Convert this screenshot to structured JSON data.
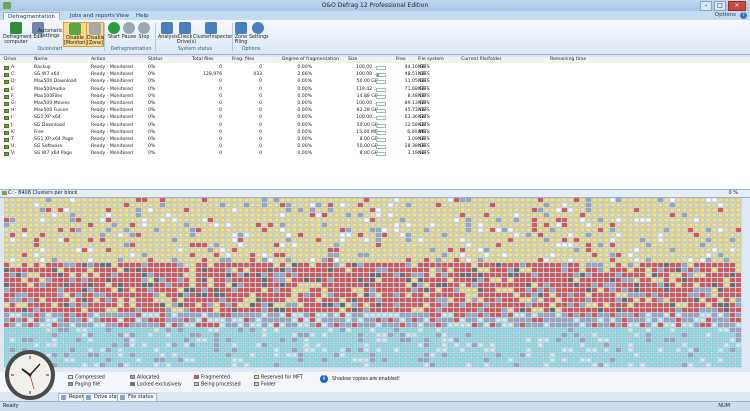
{
  "window": {
    "title": "O&O Defrag 12 Professional Edition"
  },
  "menu_tabs": [
    "Defragmentation",
    "Jobs and reports",
    "View",
    "Help"
  ],
  "options_label": "Options",
  "help_glyph": "?",
  "ribbon": {
    "buttons": [
      {
        "label1": "Defragment",
        "label2": "computer",
        "icon": "defragment-icon",
        "color": "#2f8a3a"
      },
      {
        "label1": "Edit",
        "label2": "settings",
        "icon": "edit-icon",
        "color": "#6c88a8"
      },
      {
        "label1": "Automatic",
        "label2": "",
        "icon": "automatic-icon",
        "color": "#6c88a8"
      },
      {
        "label1": "Disable",
        "label2": "[Monitoring]",
        "icon": "disable-monitoring-icon",
        "color": "#5aa642"
      },
      {
        "label1": "Disable",
        "label2": "[Zone]",
        "icon": "disable-zone-icon",
        "color": "#a8a8a8"
      },
      {
        "label1": "Start",
        "label2": "",
        "icon": "start-icon",
        "color": "#2e9e3c"
      },
      {
        "label1": "Pause",
        "label2": "",
        "icon": "pause-icon",
        "color": "#9aa8b6"
      },
      {
        "label1": "Stop",
        "label2": "",
        "icon": "stop-icon",
        "color": "#9aa8b6"
      },
      {
        "label1": "Analysis",
        "label2": "",
        "icon": "analysis-icon",
        "color": "#4a7fbf"
      },
      {
        "label1": "Check",
        "label2": "Drive(s)",
        "icon": "check-drive-icon",
        "color": "#4a7fbf"
      },
      {
        "label1": "ClusterInspector",
        "label2": "",
        "icon": "cluster-inspector-icon",
        "color": "#4a7fbf"
      },
      {
        "label1": "Zone",
        "label2": "Filing",
        "icon": "zone-filing-icon",
        "color": "#4a7fbf"
      },
      {
        "label1": "Settings",
        "label2": "",
        "icon": "settings-icon",
        "color": "#4a7fbf"
      }
    ],
    "groups": [
      "Quickstart",
      "Defragmentation",
      "System status",
      "Options"
    ]
  },
  "drive_columns": [
    "Drive",
    "Name",
    "Action",
    "Status",
    "Total files",
    "Frag. files",
    "Degree of fragmentation",
    "Size",
    "Free",
    "File system",
    "Current file/folder",
    "Remaining time"
  ],
  "drives": [
    {
      "drive": "A:",
      "name": "Backup",
      "action": "Ready - Monitored",
      "status": "0%",
      "total": "0",
      "frag": "0",
      "degree": "0.00%",
      "size": "100.00 ...",
      "free": "44.16 GB",
      "fs": "NTFS"
    },
    {
      "drive": "C:",
      "name": "SG W7 x64",
      "action": "Ready - Monitored",
      "status": "0%",
      "total": "128,976",
      "frag": "433",
      "degree": "2.66%",
      "size": "100.00 ...",
      "free": "48.51 GB",
      "fs": "NTFS"
    },
    {
      "drive": "D:",
      "name": "Max500 Download",
      "action": "Ready - Monitored",
      "status": "0%",
      "total": "0",
      "frag": "0",
      "degree": "0.00%",
      "size": "50.00 GB",
      "free": "11.05 GB",
      "fs": "NTFS"
    },
    {
      "drive": "E:",
      "name": "Max500Audio",
      "action": "Ready - Monitored",
      "status": "0%",
      "total": "0",
      "frag": "0",
      "degree": "0.00%",
      "size": "119.42 ...",
      "free": "71.68 GB",
      "fs": "NTFS"
    },
    {
      "drive": "F:",
      "name": "Max500Files",
      "action": "Ready - Monitored",
      "status": "0%",
      "total": "0",
      "frag": "0",
      "degree": "0.00%",
      "size": "14.88 GB",
      "free": "8.48 GB",
      "fs": "NTFS"
    },
    {
      "drive": "G:",
      "name": "Max500 Movies",
      "action": "Ready - Monitored",
      "status": "0%",
      "total": "0",
      "frag": "0",
      "degree": "0.00%",
      "size": "100.00 ...",
      "free": "89.13 GB",
      "fs": "NTFS"
    },
    {
      "drive": "H:",
      "name": "Max500 Fusion",
      "action": "Ready - Monitored",
      "status": "0%",
      "total": "0",
      "frag": "0",
      "degree": "0.00%",
      "size": "82.28 GB",
      "free": "45.73 GB",
      "fs": "NTFS"
    },
    {
      "drive": "I:",
      "name": "SG1 XP x64",
      "action": "Ready - Monitored",
      "status": "0%",
      "total": "0",
      "frag": "0",
      "degree": "0.00%",
      "size": "100.00 ...",
      "free": "63.36 GB",
      "fs": "NTFS"
    },
    {
      "drive": "J:",
      "name": "SG Download",
      "action": "Ready - Monitored",
      "status": "0%",
      "total": "0",
      "frag": "0",
      "degree": "0.00%",
      "size": "50.00 GB",
      "free": "12.58 GB",
      "fs": "NTFS"
    },
    {
      "drive": "K:",
      "name": "Free",
      "action": "Ready - Monitored",
      "status": "0%",
      "total": "0",
      "frag": "0",
      "degree": "0.00%",
      "size": "15.00 MB",
      "free": "6.00 MB",
      "fs": "NTFS"
    },
    {
      "drive": "T:",
      "name": "SG1 XP x64 Page",
      "action": "Ready - Monitored",
      "status": "0%",
      "total": "0",
      "frag": "0",
      "degree": "0.00%",
      "size": "8.00 GB",
      "free": "3.09 GB",
      "fs": "NTFS"
    },
    {
      "drive": "U:",
      "name": "SG Software",
      "action": "Ready - Monitored",
      "status": "0%",
      "total": "0",
      "frag": "0",
      "degree": "0.00%",
      "size": "50.00 GB",
      "free": "28.38 GB",
      "fs": "NTFS"
    },
    {
      "drive": "V:",
      "name": "SG W7 x64 Page",
      "action": "Ready - Monitored",
      "status": "0%",
      "total": "0",
      "frag": "0",
      "degree": "0.00%",
      "size": "8.00 GB",
      "free": "3.19 GB",
      "fs": "NTFS"
    }
  ],
  "cluster_map": {
    "title": "C:  - 8408 Clusters per block",
    "percent": "0 %"
  },
  "legend": [
    {
      "label": "Compressed",
      "color": "#c7f0f2"
    },
    {
      "label": "Paging file",
      "color": "#5ea3d8"
    },
    {
      "label": "Allocated",
      "color": "#9aa9c2"
    },
    {
      "label": "Locked exclusively",
      "color": "#6b6b6b"
    },
    {
      "label": "Fragmented",
      "color": "#e05353"
    },
    {
      "label": "Being processed",
      "color": "#a2e0a8"
    },
    {
      "label": "Reserved for MFT",
      "color": "#f2e28a"
    },
    {
      "label": "Folder",
      "color": "#f3c77c"
    }
  ],
  "shadow_copies": "Shadow copies are enabled!",
  "bottom_tabs": [
    "Reports",
    "Drive status",
    "File status"
  ],
  "status": {
    "left": "Ready",
    "right": "NUM"
  }
}
